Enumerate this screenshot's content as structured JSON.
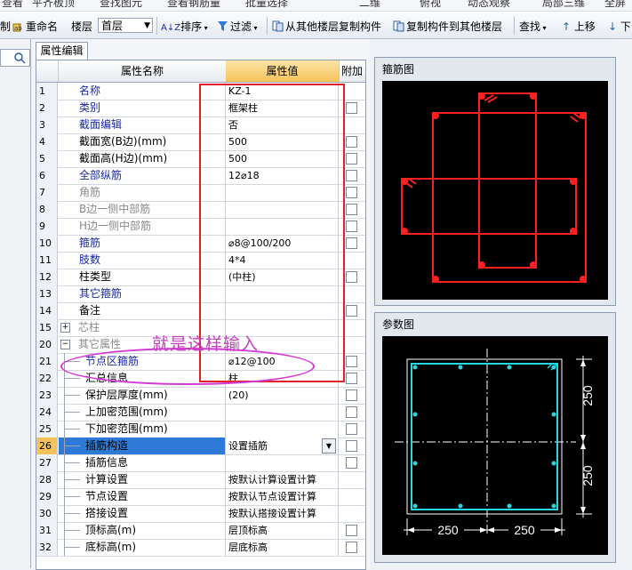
{
  "top_toolbar": {
    "items": [
      "查看",
      "平齐板顶",
      "查找图元",
      "查看钢筋量",
      "批量选择",
      "二维",
      "俯视",
      "动态观察",
      "局部三维",
      "全屏"
    ]
  },
  "toolbar": {
    "item0": "制",
    "rename_label": "重命名",
    "floor_label": "楼层",
    "floor_value": "首层",
    "sort_label": "排序",
    "filter_label": "过滤",
    "copy_from_label": "从其他楼层复制构件",
    "copy_to_label": "复制构件到其他楼层",
    "find_label": "查找",
    "up_label": "上移",
    "down_label": "下"
  },
  "tab": {
    "label": "属性编辑"
  },
  "columns": {
    "name": "属性名称",
    "value": "属性值",
    "extra": "附加"
  },
  "rows": [
    {
      "n": "1",
      "name": "名称",
      "value": "KZ-1",
      "color": "blue",
      "cb": false,
      "indent": 0
    },
    {
      "n": "2",
      "name": "类别",
      "value": "框架柱",
      "color": "blue",
      "cb": true,
      "indent": 0
    },
    {
      "n": "3",
      "name": "截面编辑",
      "value": "否",
      "color": "blue",
      "cb": false,
      "indent": 0
    },
    {
      "n": "4",
      "name": "截面宽(B边)(mm)",
      "value": "500",
      "color": "black",
      "cb": true,
      "indent": 0
    },
    {
      "n": "5",
      "name": "截面高(H边)(mm)",
      "value": "500",
      "color": "black",
      "cb": true,
      "indent": 0
    },
    {
      "n": "6",
      "name": "全部纵筋",
      "value": "12⌀18",
      "color": "blue",
      "cb": true,
      "indent": 0
    },
    {
      "n": "7",
      "name": "角筋",
      "value": "",
      "color": "grey",
      "cb": true,
      "indent": 0
    },
    {
      "n": "8",
      "name": "B边一侧中部筋",
      "value": "",
      "color": "grey",
      "cb": true,
      "indent": 0
    },
    {
      "n": "9",
      "name": "H边一侧中部筋",
      "value": "",
      "color": "grey",
      "cb": true,
      "indent": 0
    },
    {
      "n": "10",
      "name": "箍筋",
      "value": "⌀8@100/200",
      "color": "blue",
      "cb": true,
      "indent": 0
    },
    {
      "n": "11",
      "name": "肢数",
      "value": "4*4",
      "color": "blue",
      "cb": false,
      "indent": 0
    },
    {
      "n": "12",
      "name": "柱类型",
      "value": "(中柱)",
      "color": "black",
      "cb": true,
      "indent": 0
    },
    {
      "n": "13",
      "name": "其它箍筋",
      "value": "",
      "color": "blue",
      "cb": false,
      "indent": 0
    },
    {
      "n": "14",
      "name": "备注",
      "value": "",
      "color": "black",
      "cb": true,
      "indent": 0
    },
    {
      "n": "15",
      "name": "芯柱",
      "value": "",
      "color": "grey",
      "cb": false,
      "indent": 0,
      "exp": "+"
    },
    {
      "n": "20",
      "name": "其它属性",
      "value": "",
      "color": "grey",
      "cb": false,
      "indent": 0,
      "exp": "−"
    },
    {
      "n": "21",
      "name": "节点区箍筋",
      "value": "⌀12@100",
      "color": "blue",
      "cb": true,
      "indent": 1
    },
    {
      "n": "22",
      "name": "汇总信息",
      "value": "柱",
      "color": "black",
      "cb": true,
      "indent": 1
    },
    {
      "n": "23",
      "name": "保护层厚度(mm)",
      "value": "(20)",
      "color": "black",
      "cb": true,
      "indent": 1
    },
    {
      "n": "24",
      "name": "上加密范围(mm)",
      "value": "",
      "color": "black",
      "cb": true,
      "indent": 1
    },
    {
      "n": "25",
      "name": "下加密范围(mm)",
      "value": "",
      "color": "black",
      "cb": true,
      "indent": 1
    },
    {
      "n": "26",
      "name": "插筋构造",
      "value": "设置插筋",
      "color": "black",
      "cb": true,
      "indent": 1,
      "sel": true
    },
    {
      "n": "27",
      "name": "插筋信息",
      "value": "",
      "color": "black",
      "cb": true,
      "indent": 1
    },
    {
      "n": "28",
      "name": "计算设置",
      "value": "按默认计算设置计算",
      "color": "black",
      "cb": false,
      "indent": 1
    },
    {
      "n": "29",
      "name": "节点设置",
      "value": "按默认节点设置计算",
      "color": "black",
      "cb": false,
      "indent": 1
    },
    {
      "n": "30",
      "name": "搭接设置",
      "value": "按默认搭接设置计算",
      "color": "black",
      "cb": false,
      "indent": 1
    },
    {
      "n": "31",
      "name": "顶标高(m)",
      "value": "层顶标高",
      "color": "black",
      "cb": true,
      "indent": 1
    },
    {
      "n": "32",
      "name": "底标高(m)",
      "value": "层底标高",
      "color": "black",
      "cb": true,
      "indent": 1
    }
  ],
  "annotation": {
    "text": "就是这样输入"
  },
  "stirrup_panel": {
    "title": "箍筋图"
  },
  "param_panel": {
    "title": "参数图",
    "dim_v_top": "250",
    "dim_v_bottom": "250",
    "dim_h_left": "250",
    "dim_h_right": "250"
  },
  "colors": {
    "stirrup": "#ff2020",
    "param": "#27d6e0",
    "dim": "#ffffff",
    "annotation": "#c640c0",
    "highlight": "#e1212b"
  }
}
